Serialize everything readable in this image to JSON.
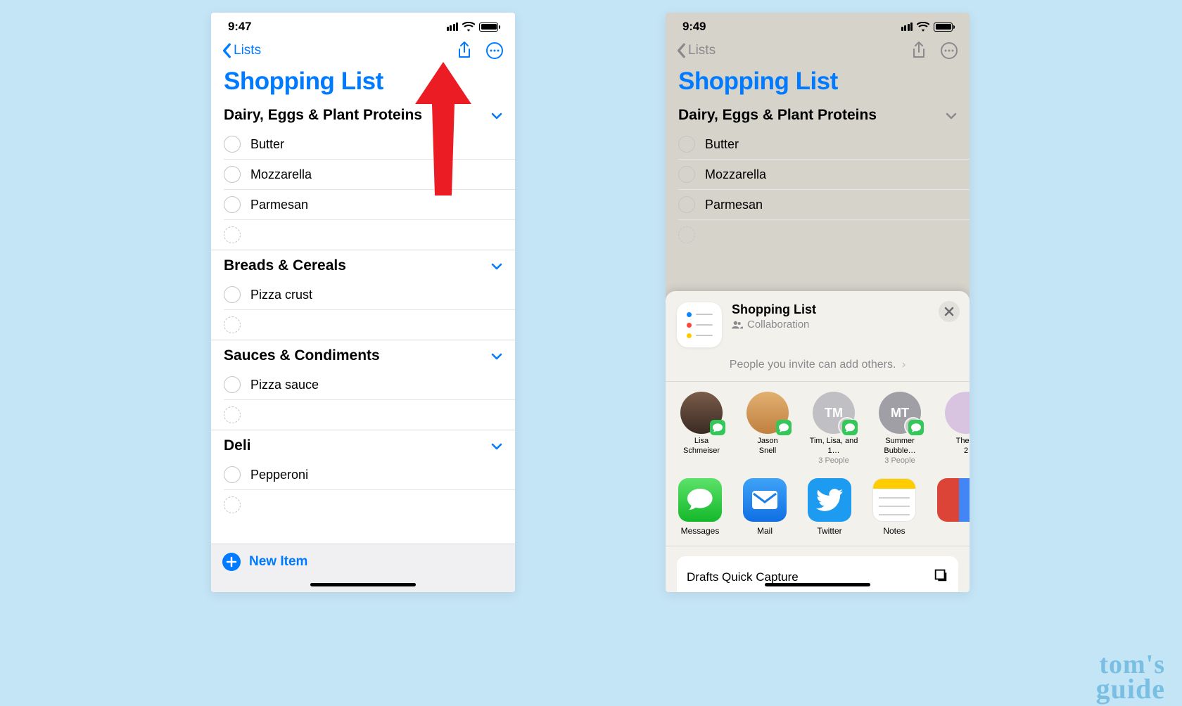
{
  "left": {
    "time": "9:47",
    "back": "Lists",
    "title": "Shopping List",
    "sections": [
      {
        "name": "Dairy, Eggs & Plant Proteins",
        "items": [
          "Butter",
          "Mozzarella",
          "Parmesan"
        ]
      },
      {
        "name": "Breads & Cereals",
        "items": [
          "Pizza crust"
        ]
      },
      {
        "name": "Sauces & Condiments",
        "items": [
          "Pizza sauce"
        ]
      },
      {
        "name": "Deli",
        "items": [
          "Pepperoni"
        ]
      }
    ],
    "newitem": "New Item"
  },
  "right": {
    "time": "9:49",
    "back": "Lists",
    "title": "Shopping List",
    "sections": [
      {
        "name": "Dairy, Eggs & Plant Proteins",
        "items": [
          "Butter",
          "Mozzarella",
          "Parmesan"
        ]
      }
    ],
    "sheet": {
      "title": "Shopping List",
      "subtitle": "Collaboration",
      "invite": "People you invite can add others.",
      "contacts": [
        {
          "name1": "Lisa",
          "name2": "Schmeiser",
          "sub": ""
        },
        {
          "name1": "Jason",
          "name2": "Snell",
          "sub": ""
        },
        {
          "name1": "Tim, Lisa, and 1…",
          "name2": "",
          "sub": "3 People",
          "initials": "TM"
        },
        {
          "name1": "Summer Bubble…",
          "name2": "",
          "sub": "3 People",
          "initials": "MT"
        },
        {
          "name1": "The F",
          "name2": "2",
          "sub": ""
        }
      ],
      "apps": [
        {
          "label": "Messages"
        },
        {
          "label": "Mail"
        },
        {
          "label": "Twitter"
        },
        {
          "label": "Notes"
        }
      ],
      "action": "Drafts Quick Capture"
    }
  },
  "watermark": {
    "line1": "tom's",
    "line2": "guide"
  }
}
